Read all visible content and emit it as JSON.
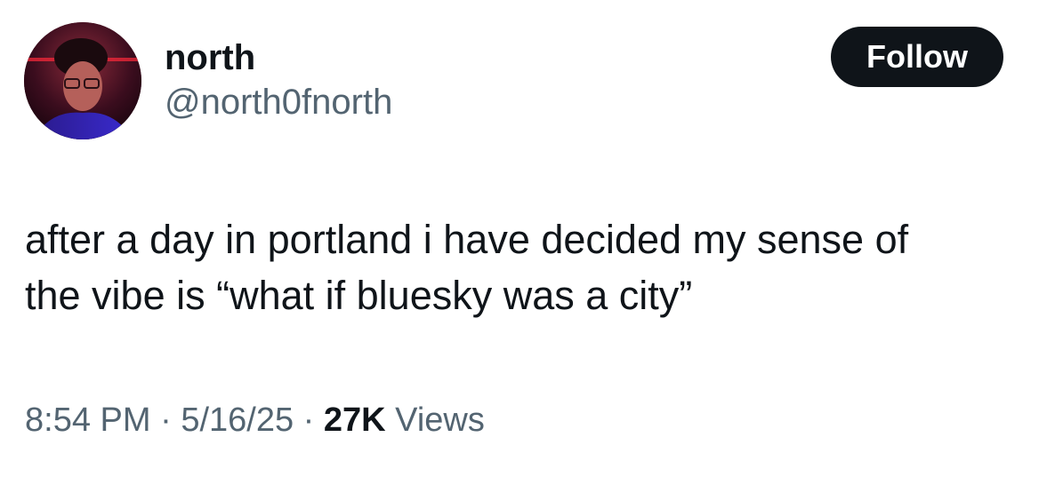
{
  "author": {
    "display_name": "north",
    "handle": "@north0fnorth",
    "avatar_icon": "profile-photo"
  },
  "follow_button": {
    "label": "Follow"
  },
  "tweet": {
    "text_line1": "after a day in portland i have decided my sense of",
    "text_line2": "the vibe is “what if bluesky was a city”"
  },
  "meta": {
    "time": "8:54 PM",
    "separator": "·",
    "date": "5/16/25",
    "views_count": "27K",
    "views_label": "Views"
  },
  "colors": {
    "text_primary": "#0f1419",
    "text_secondary": "#536471",
    "button_bg": "#0f1419",
    "button_text": "#ffffff"
  }
}
